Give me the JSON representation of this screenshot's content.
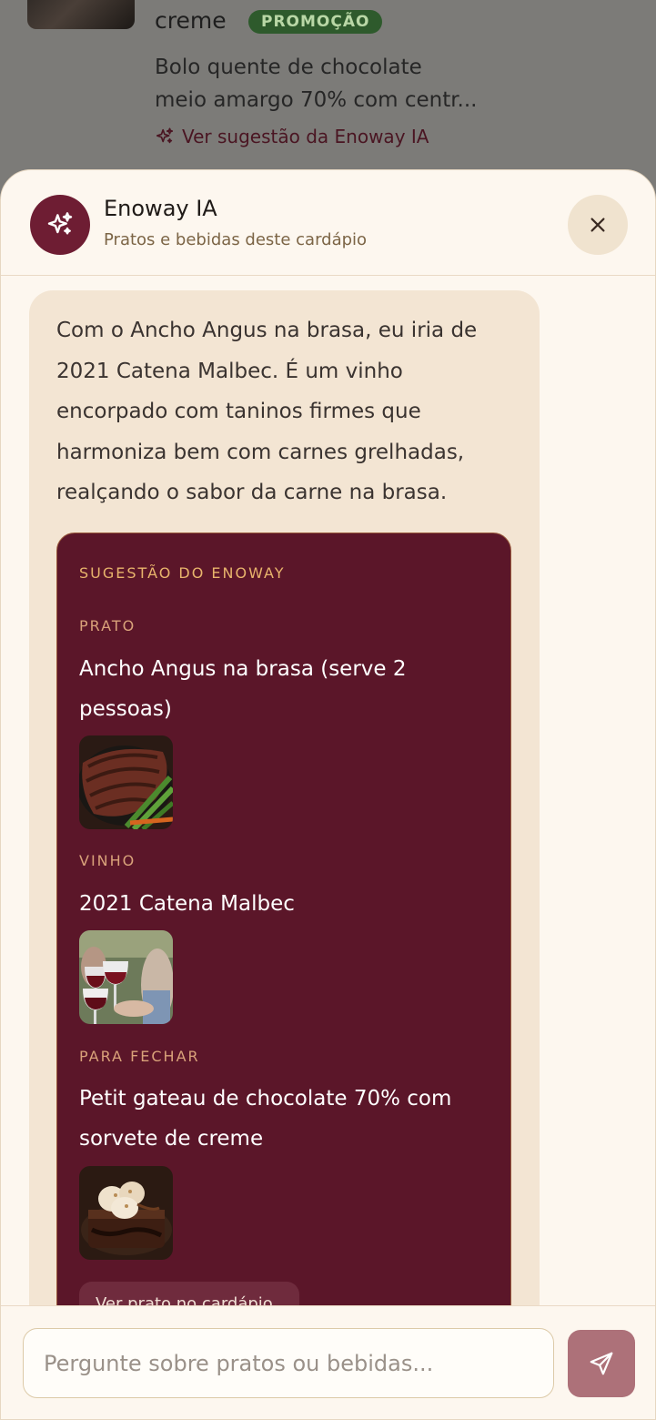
{
  "background_item": {
    "title": "creme",
    "badge": "PROMOÇÃO",
    "description_lines": [
      "Bolo quente de chocolate",
      "meio amargo 70% com centr..."
    ],
    "link_label": "Ver sugestão da Enoway IA"
  },
  "sheet": {
    "title": "Enoway IA",
    "subtitle": "Pratos e bebidas deste cardápio"
  },
  "message": {
    "lines": [
      "Com o Ancho Angus na brasa, eu iria de",
      "2021 Catena Malbec. É um vinho",
      "encorpado com taninos firmes que",
      "harmoniza bem com carnes grelhadas,",
      "realçando o sabor da carne na brasa."
    ]
  },
  "suggestion": {
    "heading": "SUGESTÃO DO ENOWAY",
    "dish_label": "PRATO",
    "dish_name_lines": [
      "Ancho Angus na brasa (serve 2",
      "pessoas)"
    ],
    "wine_label": "VINHO",
    "wine_name_lines": [
      "2021 Catena Malbec"
    ],
    "dessert_label": "PARA FECHAR",
    "dessert_name_lines": [
      "Petit gateau de chocolate 70% com",
      "sorvete de creme"
    ],
    "button_label": "Ver prato no cardápio"
  },
  "input": {
    "placeholder": "Pergunte sobre pratos ou bebidas..."
  },
  "icons": {
    "sparkle": "sparkles-icon",
    "close": "close-icon",
    "send": "send-icon"
  },
  "colors": {
    "brand_wine": "#6e1d33",
    "card_bg": "#5b1629",
    "accent_gold": "#e8b46c",
    "badge_green": "#2e5a2c",
    "send_button": "#ad7179"
  }
}
